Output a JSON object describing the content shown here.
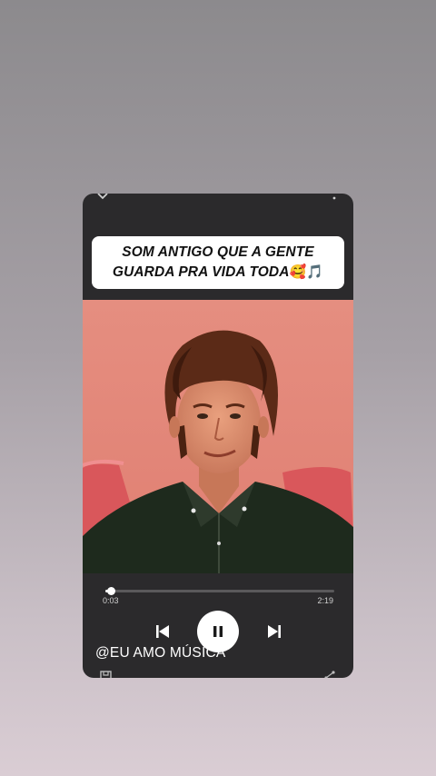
{
  "caption": {
    "line1": "SOM ANTIGO QUE A GENTE",
    "line2": "GUARDA PRA VIDA TODA",
    "emojis": "🥰🎵"
  },
  "player": {
    "elapsed": "0:03",
    "total": "2:19",
    "progress_fraction": 0.023,
    "state": "playing"
  },
  "handle": "@EU AMO MÚSICA",
  "icons": {
    "top_left": "chevron-down-icon",
    "top_right": "more-vertical-icon",
    "prev": "skip-previous-icon",
    "play_pause": "pause-icon",
    "next": "skip-next-icon",
    "bottom_left": "save-icon",
    "bottom_right": "share-icon"
  }
}
